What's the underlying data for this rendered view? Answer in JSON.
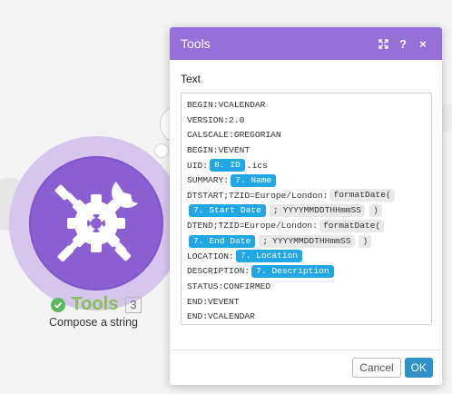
{
  "module": {
    "name": "Tools",
    "number": "3",
    "subtitle": "Compose a string",
    "icon": "tools-icon",
    "status_icon": "check-icon",
    "colors": {
      "circle": "#8a5fd1",
      "ring": "#d6c6ee",
      "name": "#86c152",
      "status": "#5ab85d"
    }
  },
  "dialog": {
    "title": "Tools",
    "header_icons": [
      "expand-icon",
      "help-icon",
      "close-icon"
    ],
    "help_label": "?",
    "close_label": "×",
    "field_label": "Text",
    "cancel_label": "Cancel",
    "ok_label": "OK",
    "colors": {
      "header": "#9470d8",
      "pill": "#21a7e5",
      "ok": "#2f91c8"
    },
    "lines": [
      {
        "text": "BEGIN:VCALENDAR"
      },
      {
        "text": "VERSION:2.0"
      },
      {
        "text": "CALSCALE:GREGORIAN"
      },
      {
        "text": "BEGIN:VEVENT"
      },
      {
        "pre": "UID:",
        "pill": "8. ID",
        "post": ".ics"
      },
      {
        "pre": "SUMMARY:",
        "pill": "7. Name"
      },
      {
        "pre": "DTSTART;TZID=Europe/London:",
        "fn": "formatDate("
      },
      {
        "pill": "7. Start Date",
        "sep": ";",
        "arg": "YYYYMMDDTHHmmSS",
        "close": ")"
      },
      {
        "pre": "DTEND;TZID=Europe/London:",
        "fn": "formatDate("
      },
      {
        "pill": "7. End Date",
        "sep": ";",
        "arg": "YYYYMMDDTHHmmSS",
        "close": ")"
      },
      {
        "pre": "LOCATION:",
        "pill": "7. Location"
      },
      {
        "pre": "DESCRIPTION:",
        "pill": "7. Description"
      },
      {
        "text": "STATUS:CONFIRMED"
      },
      {
        "text": "END:VEVENT"
      },
      {
        "text": "END:VCALENDAR"
      }
    ]
  }
}
